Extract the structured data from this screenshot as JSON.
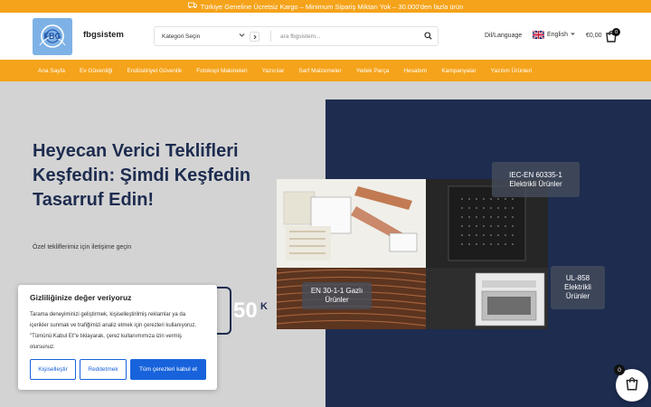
{
  "topbar": {
    "text": "Türkiye Geneline Ücretsiz Kargo – Minimum Sipariş Miktarı Yok – 30.000'den fazla ürün"
  },
  "header": {
    "brand": "fbgsistem",
    "logo_text": "FBG",
    "category_select": "Kategori Seçin",
    "search_placeholder": "ara fbgsistem...",
    "lang_label": "Dil/Language",
    "language": "English",
    "cart_total": "€0,00",
    "cart_count": "0"
  },
  "nav": {
    "items": [
      "Ana Sayfa",
      "Ev Güvenliği",
      "Endüstiriyel Güvenlik",
      "Fotokopi Makineleri",
      "Yazıcılar",
      "Sarf Malzemeler",
      "Yedek Parça",
      "Hesabım",
      "Kampanyalar",
      "Yazılım Ürünleri"
    ]
  },
  "hero": {
    "title": "Heyecan Verici Teklifleri Keşfedin: Şimdi Keşfedin Tasarruf Edin!",
    "subtitle": "Özel tekliflerimiz için iletişime geçin",
    "tags": [
      "IEC-EN 60335-1 Elektrikli Ürünler",
      "EN 30-1-1 Gazlı Ürünler",
      "UL-858 Elektrikli Ürünler"
    ],
    "counter_value": "50",
    "counter_unit": "K"
  },
  "cookie": {
    "title": "Gizliliğinize değer veriyoruz",
    "body": "Tarama deneyiminizi geliştirmek, kişiselleştirilmiş reklamlar ya da içerikler sunmak ve trafiğimizi analiz etmek için çerezleri kullanıyoruz. \"Tümünü Kabul Et\"e tıklayarak, çerez kullanımımıza izin vermiş olursunuz.",
    "customize": "Kişiselleştir",
    "reject": "Reddetmek",
    "accept": "Tüm çerezleri kabul et"
  },
  "floating_cart": {
    "count": "0"
  },
  "colors": {
    "accent": "#f5a31a",
    "navy": "#1d2c4f",
    "cookie_blue": "#1863dc"
  },
  "icons": [
    "truck-icon",
    "chevron-down-icon",
    "chevron-right-icon",
    "search-icon",
    "uk-flag-icon",
    "cart-icon"
  ]
}
